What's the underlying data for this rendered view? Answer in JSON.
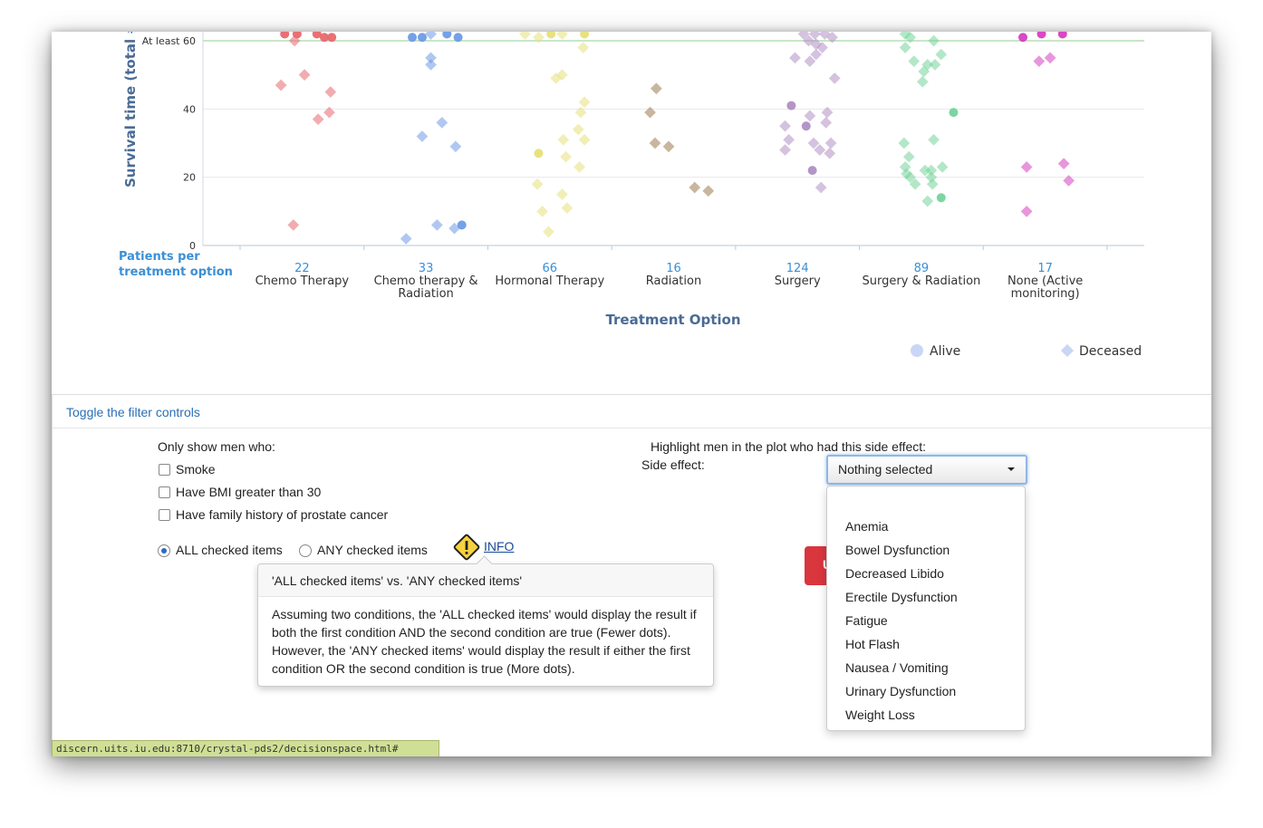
{
  "chart_data": {
    "type": "scatter",
    "ylabel": "Survival time (total # o",
    "xlabel": "Treatment Option",
    "y_ticks": [
      "0",
      "20",
      "40",
      "At least 60"
    ],
    "y_tick_values": [
      0,
      20,
      40,
      60
    ],
    "ylim": [
      0,
      62
    ],
    "patients_label": [
      "Patients per",
      "treatment option"
    ],
    "categories": [
      {
        "count": "22",
        "name_lines": [
          "Chemo Therapy"
        ],
        "color": "#e8686e"
      },
      {
        "count": "33",
        "name_lines": [
          "Chemo therapy &",
          "Radiation"
        ],
        "color": "#6f9be6"
      },
      {
        "count": "66",
        "name_lines": [
          "Hormonal Therapy"
        ],
        "color": "#e6e07a"
      },
      {
        "count": "16",
        "name_lines": [
          "Radiation"
        ],
        "color": "#9a7a4c"
      },
      {
        "count": "124",
        "name_lines": [
          "Surgery"
        ],
        "color": "#b08fc4"
      },
      {
        "count": "89",
        "name_lines": [
          "Surgery & Radiation"
        ],
        "color": "#74d49a"
      },
      {
        "count": "17",
        "name_lines": [
          "None (Active",
          "monitoring)"
        ],
        "color": "#d63fc0"
      }
    ],
    "legend": [
      {
        "name": "Alive",
        "shape": "circle"
      },
      {
        "name": "Deceased",
        "shape": "diamond"
      }
    ],
    "points": [
      {
        "c": 0,
        "dx": -0.14,
        "y": 62,
        "s": "a"
      },
      {
        "c": 0,
        "dx": -0.04,
        "y": 62,
        "s": "a"
      },
      {
        "c": 0,
        "dx": 0.12,
        "y": 62,
        "s": "a"
      },
      {
        "c": 0,
        "dx": 0.18,
        "y": 61,
        "s": "a"
      },
      {
        "c": 0,
        "dx": 0.24,
        "y": 61,
        "s": "a"
      },
      {
        "c": 0,
        "dx": -0.06,
        "y": 60,
        "s": "d"
      },
      {
        "c": 0,
        "dx": 0.02,
        "y": 50,
        "s": "d"
      },
      {
        "c": 0,
        "dx": -0.17,
        "y": 47,
        "s": "d"
      },
      {
        "c": 0,
        "dx": 0.23,
        "y": 45,
        "s": "d"
      },
      {
        "c": 0,
        "dx": 0.22,
        "y": 39,
        "s": "d"
      },
      {
        "c": 0,
        "dx": 0.13,
        "y": 37,
        "s": "d"
      },
      {
        "c": 0,
        "dx": -0.07,
        "y": 6,
        "s": "d"
      },
      {
        "c": 1,
        "dx": -0.11,
        "y": 61,
        "s": "a"
      },
      {
        "c": 1,
        "dx": -0.03,
        "y": 61,
        "s": "a"
      },
      {
        "c": 1,
        "dx": 0.17,
        "y": 62,
        "s": "a"
      },
      {
        "c": 1,
        "dx": 0.26,
        "y": 61,
        "s": "a"
      },
      {
        "c": 1,
        "dx": 0.04,
        "y": 62,
        "s": "d"
      },
      {
        "c": 1,
        "dx": 0.04,
        "y": 55,
        "s": "d"
      },
      {
        "c": 1,
        "dx": 0.04,
        "y": 53,
        "s": "d"
      },
      {
        "c": 1,
        "dx": 0.13,
        "y": 36,
        "s": "d"
      },
      {
        "c": 1,
        "dx": -0.03,
        "y": 32,
        "s": "d"
      },
      {
        "c": 1,
        "dx": 0.24,
        "y": 29,
        "s": "d"
      },
      {
        "c": 1,
        "dx": 0.09,
        "y": 6,
        "s": "d"
      },
      {
        "c": 1,
        "dx": 0.23,
        "y": 5,
        "s": "d"
      },
      {
        "c": 1,
        "dx": 0.29,
        "y": 6,
        "s": "a"
      },
      {
        "c": 1,
        "dx": -0.16,
        "y": 2,
        "s": "d"
      },
      {
        "c": 2,
        "dx": -0.2,
        "y": 62,
        "s": "d"
      },
      {
        "c": 2,
        "dx": -0.09,
        "y": 61,
        "s": "d"
      },
      {
        "c": 2,
        "dx": 0.01,
        "y": 62,
        "s": "a"
      },
      {
        "c": 2,
        "dx": 0.1,
        "y": 62,
        "s": "d"
      },
      {
        "c": 2,
        "dx": 0.28,
        "y": 62,
        "s": "a"
      },
      {
        "c": 2,
        "dx": 0.27,
        "y": 58,
        "s": "d"
      },
      {
        "c": 2,
        "dx": 0.1,
        "y": 50,
        "s": "d"
      },
      {
        "c": 2,
        "dx": 0.05,
        "y": 49,
        "s": "d"
      },
      {
        "c": 2,
        "dx": 0.28,
        "y": 42,
        "s": "d"
      },
      {
        "c": 2,
        "dx": 0.25,
        "y": 39,
        "s": "d"
      },
      {
        "c": 2,
        "dx": 0.23,
        "y": 34,
        "s": "d"
      },
      {
        "c": 2,
        "dx": 0.28,
        "y": 31,
        "s": "d"
      },
      {
        "c": 2,
        "dx": 0.11,
        "y": 31,
        "s": "d"
      },
      {
        "c": 2,
        "dx": -0.09,
        "y": 27,
        "s": "a"
      },
      {
        "c": 2,
        "dx": 0.13,
        "y": 26,
        "s": "d"
      },
      {
        "c": 2,
        "dx": 0.24,
        "y": 23,
        "s": "d"
      },
      {
        "c": 2,
        "dx": -0.1,
        "y": 18,
        "s": "d"
      },
      {
        "c": 2,
        "dx": 0.1,
        "y": 15,
        "s": "d"
      },
      {
        "c": 2,
        "dx": 0.14,
        "y": 11,
        "s": "d"
      },
      {
        "c": 2,
        "dx": -0.06,
        "y": 10,
        "s": "d"
      },
      {
        "c": 2,
        "dx": -0.01,
        "y": 4,
        "s": "d"
      },
      {
        "c": 3,
        "dx": -0.14,
        "y": 46,
        "s": "d"
      },
      {
        "c": 3,
        "dx": -0.19,
        "y": 39,
        "s": "d"
      },
      {
        "c": 3,
        "dx": -0.15,
        "y": 30,
        "s": "d"
      },
      {
        "c": 3,
        "dx": -0.04,
        "y": 29,
        "s": "d"
      },
      {
        "c": 3,
        "dx": 0.17,
        "y": 17,
        "s": "d"
      },
      {
        "c": 3,
        "dx": 0.28,
        "y": 16,
        "s": "d"
      },
      {
        "c": 4,
        "dx": 0.05,
        "y": 62,
        "s": "d"
      },
      {
        "c": 4,
        "dx": 0.14,
        "y": 62,
        "s": "d"
      },
      {
        "c": 4,
        "dx": 0.22,
        "y": 62,
        "s": "d"
      },
      {
        "c": 4,
        "dx": 0.28,
        "y": 61,
        "s": "d"
      },
      {
        "c": 4,
        "dx": 0.09,
        "y": 60,
        "s": "d"
      },
      {
        "c": 4,
        "dx": 0.15,
        "y": 59,
        "s": "d"
      },
      {
        "c": 4,
        "dx": 0.2,
        "y": 58,
        "s": "d"
      },
      {
        "c": 4,
        "dx": 0.15,
        "y": 56,
        "s": "d"
      },
      {
        "c": 4,
        "dx": -0.02,
        "y": 55,
        "s": "d"
      },
      {
        "c": 4,
        "dx": 0.1,
        "y": 54,
        "s": "d"
      },
      {
        "c": 4,
        "dx": 0.3,
        "y": 49,
        "s": "d"
      },
      {
        "c": 4,
        "dx": -0.05,
        "y": 41,
        "s": "a"
      },
      {
        "c": 4,
        "dx": 0.24,
        "y": 39,
        "s": "d"
      },
      {
        "c": 4,
        "dx": 0.1,
        "y": 38,
        "s": "d"
      },
      {
        "c": 4,
        "dx": 0.23,
        "y": 36,
        "s": "d"
      },
      {
        "c": 4,
        "dx": -0.1,
        "y": 35,
        "s": "d"
      },
      {
        "c": 4,
        "dx": 0.07,
        "y": 35,
        "s": "a"
      },
      {
        "c": 4,
        "dx": -0.07,
        "y": 31,
        "s": "d"
      },
      {
        "c": 4,
        "dx": 0.13,
        "y": 30,
        "s": "d"
      },
      {
        "c": 4,
        "dx": 0.27,
        "y": 30,
        "s": "d"
      },
      {
        "c": 4,
        "dx": 0.18,
        "y": 28,
        "s": "d"
      },
      {
        "c": 4,
        "dx": -0.1,
        "y": 28,
        "s": "d"
      },
      {
        "c": 4,
        "dx": 0.26,
        "y": 27,
        "s": "d"
      },
      {
        "c": 4,
        "dx": 0.12,
        "y": 22,
        "s": "a"
      },
      {
        "c": 4,
        "dx": 0.19,
        "y": 17,
        "s": "d"
      },
      {
        "c": 5,
        "dx": -0.13,
        "y": 62,
        "s": "d"
      },
      {
        "c": 5,
        "dx": -0.09,
        "y": 61,
        "s": "d"
      },
      {
        "c": 5,
        "dx": 0.1,
        "y": 60,
        "s": "d"
      },
      {
        "c": 5,
        "dx": -0.13,
        "y": 58,
        "s": "d"
      },
      {
        "c": 5,
        "dx": 0.16,
        "y": 56,
        "s": "d"
      },
      {
        "c": 5,
        "dx": -0.06,
        "y": 54,
        "s": "d"
      },
      {
        "c": 5,
        "dx": 0.05,
        "y": 53,
        "s": "d"
      },
      {
        "c": 5,
        "dx": 0.11,
        "y": 53,
        "s": "d"
      },
      {
        "c": 5,
        "dx": 0.02,
        "y": 51,
        "s": "d"
      },
      {
        "c": 5,
        "dx": 0.01,
        "y": 48,
        "s": "d"
      },
      {
        "c": 5,
        "dx": 0.26,
        "y": 39,
        "s": "a"
      },
      {
        "c": 5,
        "dx": -0.14,
        "y": 30,
        "s": "d"
      },
      {
        "c": 5,
        "dx": 0.1,
        "y": 31,
        "s": "d"
      },
      {
        "c": 5,
        "dx": -0.1,
        "y": 26,
        "s": "d"
      },
      {
        "c": 5,
        "dx": -0.13,
        "y": 23,
        "s": "d"
      },
      {
        "c": 5,
        "dx": 0.03,
        "y": 22,
        "s": "d"
      },
      {
        "c": 5,
        "dx": 0.08,
        "y": 22,
        "s": "d"
      },
      {
        "c": 5,
        "dx": 0.17,
        "y": 23,
        "s": "d"
      },
      {
        "c": 5,
        "dx": -0.12,
        "y": 21,
        "s": "d"
      },
      {
        "c": 5,
        "dx": -0.09,
        "y": 20,
        "s": "d"
      },
      {
        "c": 5,
        "dx": 0.08,
        "y": 20,
        "s": "d"
      },
      {
        "c": 5,
        "dx": -0.05,
        "y": 18,
        "s": "d"
      },
      {
        "c": 5,
        "dx": 0.09,
        "y": 18,
        "s": "d"
      },
      {
        "c": 5,
        "dx": 0.16,
        "y": 14,
        "s": "a"
      },
      {
        "c": 5,
        "dx": 0.05,
        "y": 13,
        "s": "d"
      },
      {
        "c": 6,
        "dx": -0.18,
        "y": 61,
        "s": "a"
      },
      {
        "c": 6,
        "dx": -0.03,
        "y": 62,
        "s": "a"
      },
      {
        "c": 6,
        "dx": 0.14,
        "y": 62,
        "s": "a"
      },
      {
        "c": 6,
        "dx": 0.04,
        "y": 55,
        "s": "d"
      },
      {
        "c": 6,
        "dx": -0.05,
        "y": 54,
        "s": "d"
      },
      {
        "c": 6,
        "dx": -0.15,
        "y": 23,
        "s": "d"
      },
      {
        "c": 6,
        "dx": 0.15,
        "y": 24,
        "s": "d"
      },
      {
        "c": 6,
        "dx": 0.19,
        "y": 19,
        "s": "d"
      },
      {
        "c": 6,
        "dx": -0.15,
        "y": 10,
        "s": "d"
      }
    ]
  },
  "filters": {
    "toggle_label": "Toggle the filter controls",
    "only_show_label": "Only show men who:",
    "checkboxes": [
      {
        "label": "Smoke",
        "checked": false
      },
      {
        "label": "Have BMI greater than 30",
        "checked": false
      },
      {
        "label": "Have family history of prostate cancer",
        "checked": false
      }
    ],
    "radios": [
      {
        "label": "ALL checked items",
        "selected": true
      },
      {
        "label": "ANY checked items",
        "selected": false
      }
    ],
    "info_label": "INFO",
    "popover": {
      "title": "'ALL checked items' vs. 'ANY checked items'",
      "body": "Assuming two conditions, the 'ALL checked items' would display the result if both the first condition AND the second condition are true (Fewer dots). However, the 'ANY checked items' would display the result if either the first condition OR the second condition is true (More dots)."
    },
    "highlight_label": "Highlight men in the plot who had this side effect:",
    "side_effect_label": "Side effect:",
    "select_value": "Nothing selected",
    "side_effects": [
      "Anemia",
      "Bowel Dysfunction",
      "Decreased Libido",
      "Erectile Dysfunction",
      "Fatigue",
      "Hot Flash",
      "Nausea / Vomiting",
      "Urinary Dysfunction",
      "Weight Loss"
    ],
    "button_partial_text": "U"
  },
  "status_bar": {
    "url": "discern.uits.iu.edu:8710/crystal-pds2/decisionspace.html#"
  },
  "colors": {
    "accent_link": "#2a6fb5",
    "axis_title": "#4a6b94",
    "count": "#3a8fd6",
    "threshold_line": "#8fcf8f",
    "status_bar": "#d0df96"
  }
}
